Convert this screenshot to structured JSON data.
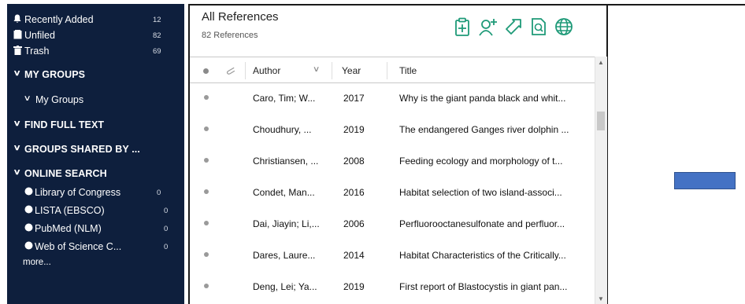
{
  "sidebar": {
    "top_items": [
      {
        "icon": "bell-icon",
        "glyph": "🔔︎",
        "label": "Recently Added",
        "count": "12"
      },
      {
        "icon": "folder-icon",
        "glyph": "▮",
        "label": "Unfiled",
        "count": "82"
      },
      {
        "icon": "trash-icon",
        "glyph": "🗑︎",
        "label": "Trash",
        "count": "69"
      }
    ],
    "sections": {
      "my_groups": "MY GROUPS",
      "my_groups_child": "My Groups",
      "find_full_text": "FIND FULL TEXT",
      "groups_shared": "GROUPS SHARED BY ...",
      "online_search": "ONLINE SEARCH"
    },
    "online_items": [
      {
        "label": "Library of Congress",
        "count": "0"
      },
      {
        "label": "LISTA (EBSCO)",
        "count": "0"
      },
      {
        "label": "PubMed (NLM)",
        "count": "0"
      },
      {
        "label": "Web of Science C...",
        "count": "0"
      }
    ],
    "more": "more..."
  },
  "main": {
    "title": "All References",
    "subtitle": "82 References",
    "toolbar_icons": [
      "insert-citation-icon",
      "add-user-icon",
      "share-icon",
      "search-document-icon",
      "online-globe-icon"
    ],
    "columns": {
      "author": "Author",
      "year": "Year",
      "title": "Title"
    },
    "rows": [
      {
        "author": "Caro, Tim; W...",
        "year": "2017",
        "title": "Why is the giant panda black and whit..."
      },
      {
        "author": "Choudhury, ...",
        "year": "2019",
        "title": "The endangered Ganges river dolphin ..."
      },
      {
        "author": "Christiansen, ...",
        "year": "2008",
        "title": "Feeding ecology and morphology of t..."
      },
      {
        "author": "Condet, Man...",
        "year": "2016",
        "title": "Habitat selection of two island-associ..."
      },
      {
        "author": "Dai, Jiayin; Li,...",
        "year": "2006",
        "title": "Perfluorooctanesulfonate and perfluor..."
      },
      {
        "author": "Dares, Laure...",
        "year": "2014",
        "title": "Habitat Characteristics of the Critically..."
      },
      {
        "author": "Deng, Lei; Ya...",
        "year": "2019",
        "title": "First report of Blastocystis in giant pan..."
      }
    ]
  },
  "colors": {
    "sidebar_bg": "#0e1f3d",
    "toolbar_icon": "#1e9a78",
    "blue_bar": "#4472c4"
  }
}
